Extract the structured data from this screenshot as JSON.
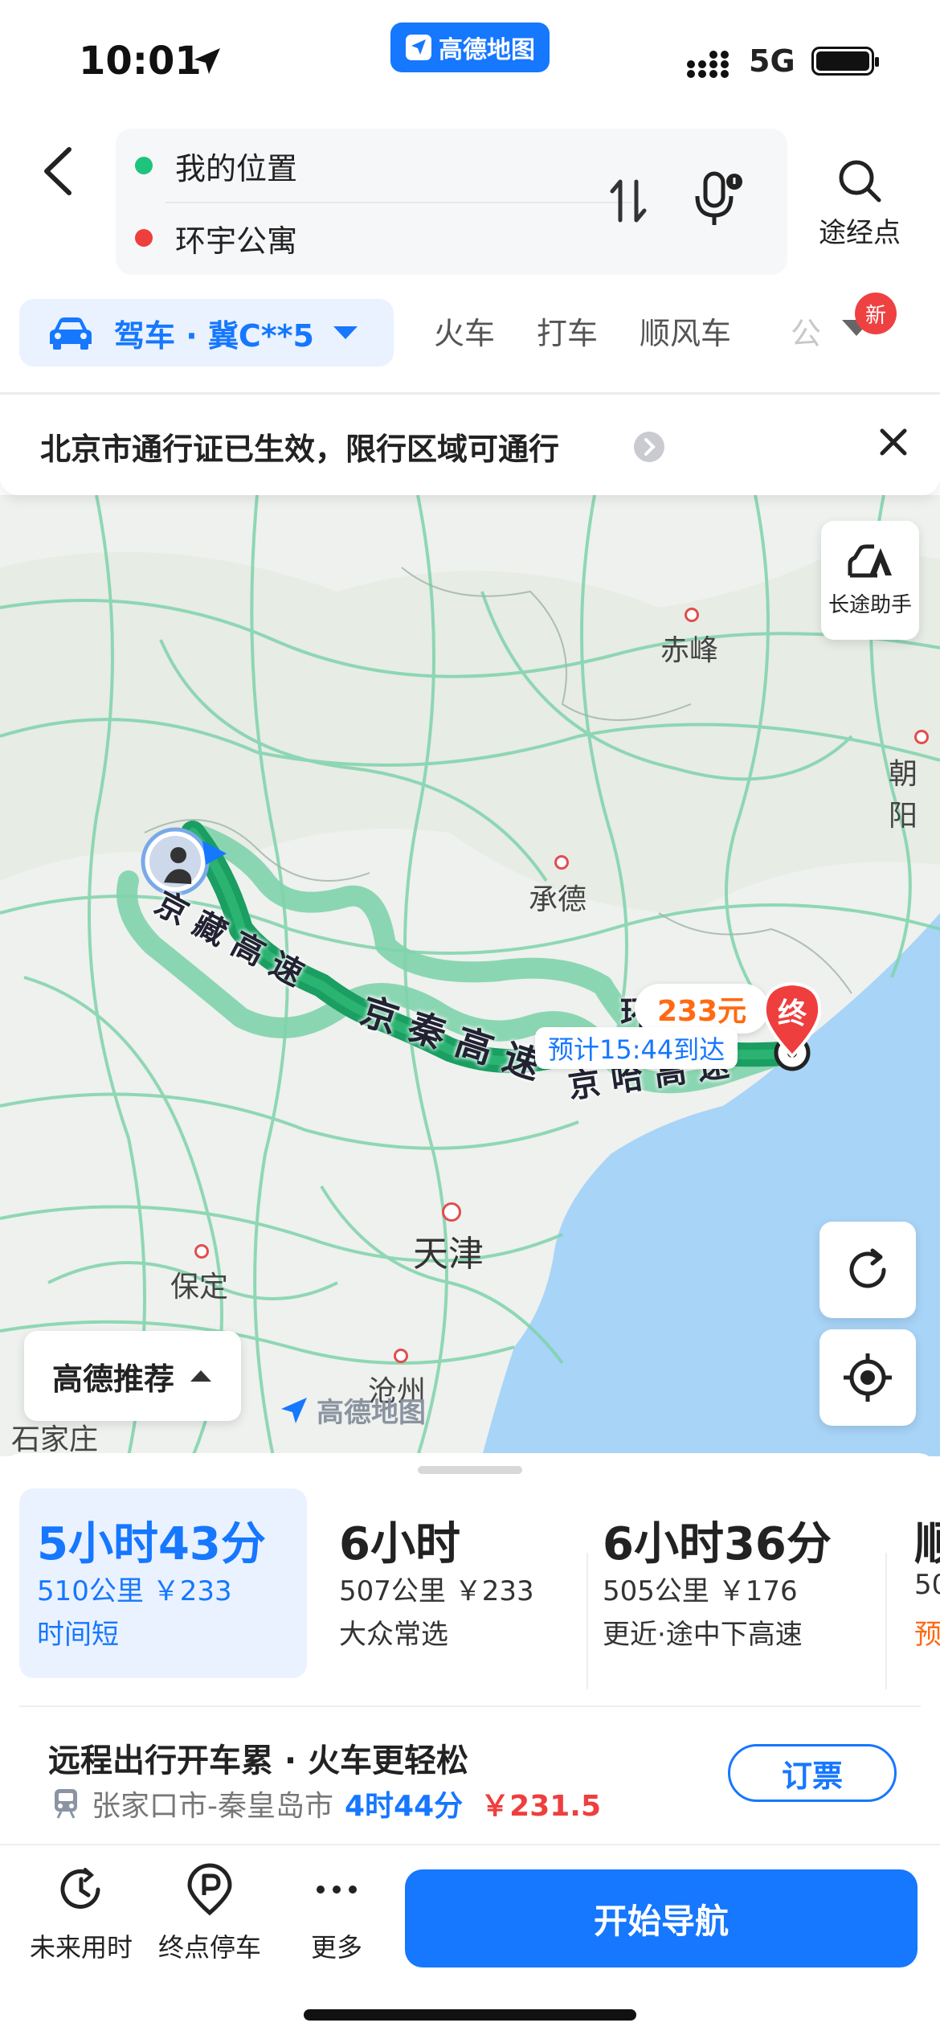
{
  "status_bar": {
    "time": "10:01",
    "network": "5G",
    "app_name": "高德地图"
  },
  "search": {
    "from": "我的位置",
    "to": "环宇公寓",
    "via_label": "途经点"
  },
  "mode_tabs": {
    "active": "驾车 · 冀C**5",
    "items": [
      "火车",
      "打车",
      "顺风车"
    ],
    "faded": "公",
    "new_badge": "新"
  },
  "notice": {
    "text": "北京市通行证已生效，限行区域可通行"
  },
  "map": {
    "cities": [
      "赤峰",
      "朝阳",
      "承德",
      "天津",
      "保定",
      "沧州",
      "石家庄"
    ],
    "road_labels": {
      "jingzang": "京 藏 高 速",
      "jingqin": "京 秦 高 速",
      "jingha": "京 哈 高 速",
      "partial": "环"
    },
    "price_tag": "233元",
    "eta": "预计15:44到达",
    "end_marker": "终",
    "long_trip_helper": "长途助手",
    "recommend_label": "高德推荐",
    "watermark": "高德地图"
  },
  "routes": [
    {
      "time": "5小时43分",
      "distance": "510公里 ￥233",
      "tag": "时间短",
      "selected": true
    },
    {
      "time": "6小时",
      "distance": "507公里 ￥233",
      "tag": "大众常选",
      "selected": false
    },
    {
      "time": "6小时36分",
      "distance": "505公里 ￥176",
      "tag": "更近·途中下高速",
      "selected": false
    },
    {
      "time": "顺",
      "distance": "50",
      "tag": "预",
      "selected": false
    }
  ],
  "train_promo": {
    "title": "远程出行开车累 · 火车更轻松",
    "route": "张家口市-秦皇岛市",
    "duration": "4时44分",
    "price": "￥231.5",
    "book_label": "订票"
  },
  "bottom_bar": {
    "future_time": "未来用时",
    "parking": "终点停车",
    "more": "更多",
    "start_nav": "开始导航"
  },
  "colors": {
    "brand_blue": "#1677ff",
    "route_green": "#1a9e62",
    "alt_route": "#7fd3ab",
    "sea": "#a8d4f7"
  }
}
